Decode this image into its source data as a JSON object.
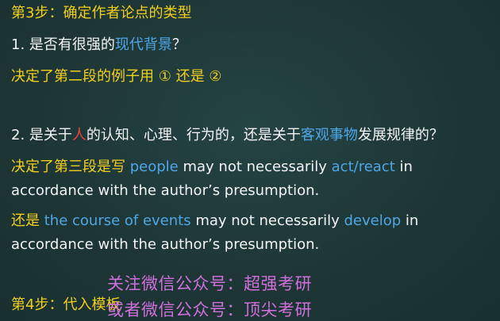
{
  "step3": {
    "text": "第3步：确定作者论点的类型"
  },
  "q1": {
    "prefix": "1. 是否有很强的",
    "highlight": "现代背景",
    "suffix": "？"
  },
  "a1": {
    "text": "决定了第二段的例子用 ① 还是 ②"
  },
  "q2": {
    "p1": "2. 是关于",
    "h1": "人",
    "p2": "的认知、心理、行为的，还是关于",
    "h2": "客观事物",
    "p3": "发展规律的？"
  },
  "a2": {
    "lead": "决定了第三段是写 ",
    "h1": "people",
    "mid": " may not necessarily ",
    "h2": "act/react",
    "tail": " in",
    "line2": "accordance with the author’s presumption."
  },
  "a3": {
    "lead": "还是 ",
    "h1": "the course of events",
    "mid": " may not necessarily ",
    "h2": "develop",
    "tail": " in",
    "line2": "accordance with the author’s presumption."
  },
  "step4": {
    "text": "第4步：代入模板"
  },
  "watermark": {
    "line1": "关注微信公众号：超强考研",
    "line2": "或者微信公众号：顶尖考研"
  },
  "colors": {
    "background": "#1e3838",
    "heading_yellow": "#f2cf1d",
    "body_white": "#f4f4f4",
    "highlight_blue": "#4fa7e6",
    "highlight_red": "#f0423d",
    "watermark_pink": "#d070dc"
  }
}
